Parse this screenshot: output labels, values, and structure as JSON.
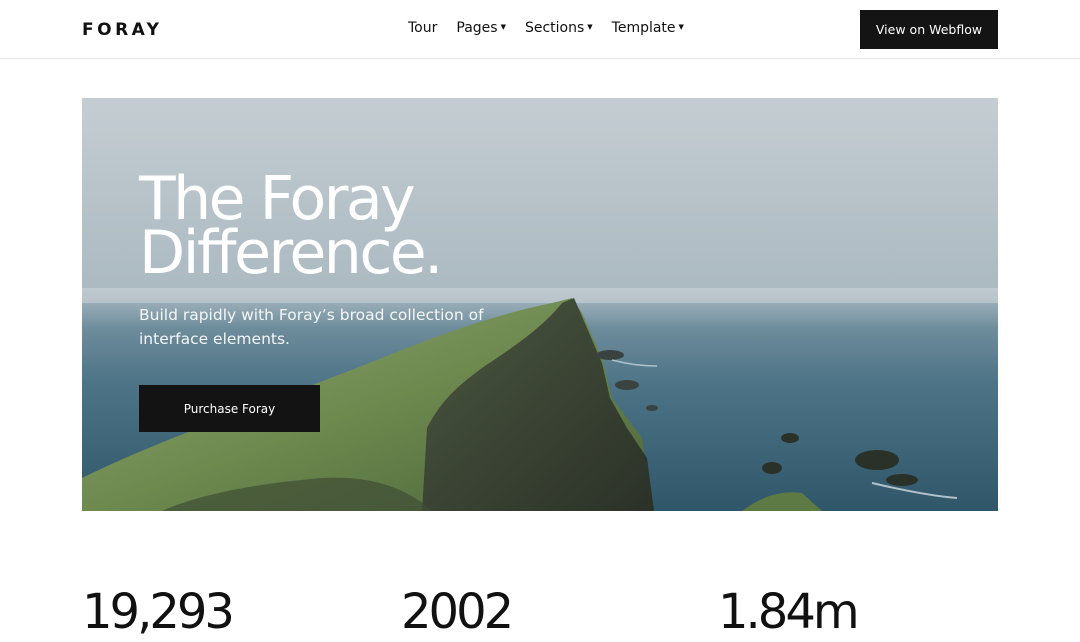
{
  "nav": {
    "logo": "FORAY",
    "links": [
      {
        "label": "Tour",
        "dropdown": false
      },
      {
        "label": "Pages",
        "dropdown": true
      },
      {
        "label": "Sections",
        "dropdown": true
      },
      {
        "label": "Template",
        "dropdown": true
      }
    ],
    "cta_label": "View on Webflow"
  },
  "hero": {
    "title_line1": "The Foray",
    "title_line2": "Difference.",
    "subtitle": "Build rapidly with Foray’s broad collection of interface elements.",
    "button_label": "Purchase Foray"
  },
  "stats": [
    {
      "value": "19,293"
    },
    {
      "value": "2002"
    },
    {
      "value": "1.84m"
    }
  ],
  "colors": {
    "button_bg": "#141414",
    "text": "#111111",
    "sea": "#3f6a7e",
    "grass": "#6d8a4e"
  }
}
